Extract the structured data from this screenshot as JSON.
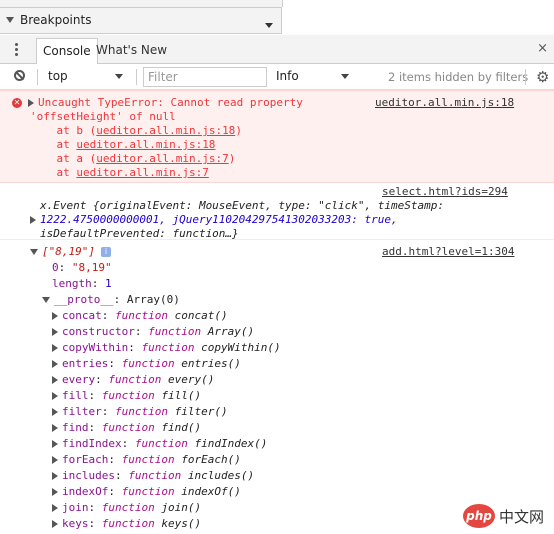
{
  "breakpoints_label": "Breakpoints",
  "tabs": {
    "console": "Console",
    "whats_new": "What's New",
    "close": "×"
  },
  "filterbar": {
    "context": "top",
    "filter_placeholder": "Filter",
    "level": "Info",
    "hidden_msg": "2 items hidden by filters"
  },
  "error": {
    "l1": "Uncaught TypeError: Cannot read property",
    "l2": "'offsetHeight' of null",
    "src": "ueditor.all.min.js:18",
    "s1_pre": "    at b (",
    "s1_link": "ueditor.all.min.js:18",
    "s1_post": ")",
    "s2_pre": "    at ",
    "s2_link": "ueditor.all.min.js:18",
    "s3_pre": "    at a (",
    "s3_link": "ueditor.all.min.js:7",
    "s3_post": ")",
    "s4_pre": "    at ",
    "s4_link": "ueditor.all.min.js:7"
  },
  "event": {
    "src": "select.html?ids=294",
    "l1": "x.Event {originalEvent: MouseEvent, type: \"click\", timeStamp:",
    "l2": "1222.4750000000001, jQuery110204297541302033203: true,",
    "l3": "isDefaultPrevented: function…}"
  },
  "array": {
    "src": "add.html?level=1:304",
    "head": "[\"8,19\"]",
    "info": "i",
    "idx_key": "0",
    "idx_val": "\"8,19\"",
    "len_key": "length",
    "len_val": "1",
    "proto_key": "__proto__",
    "proto_val": "Array(0)",
    "methods": [
      {
        "name": "concat",
        "sig": "concat()"
      },
      {
        "name": "constructor",
        "sig": "Array()"
      },
      {
        "name": "copyWithin",
        "sig": "copyWithin()"
      },
      {
        "name": "entries",
        "sig": "entries()"
      },
      {
        "name": "every",
        "sig": "every()"
      },
      {
        "name": "fill",
        "sig": "fill()"
      },
      {
        "name": "filter",
        "sig": "filter()"
      },
      {
        "name": "find",
        "sig": "find()"
      },
      {
        "name": "findIndex",
        "sig": "findIndex()"
      },
      {
        "name": "forEach",
        "sig": "forEach()"
      },
      {
        "name": "includes",
        "sig": "includes()"
      },
      {
        "name": "indexOf",
        "sig": "indexOf()"
      },
      {
        "name": "join",
        "sig": "join()"
      },
      {
        "name": "keys",
        "sig": "keys()"
      }
    ],
    "fn_kw": "function"
  },
  "watermark": {
    "badge": "php",
    "text": "中文网"
  }
}
